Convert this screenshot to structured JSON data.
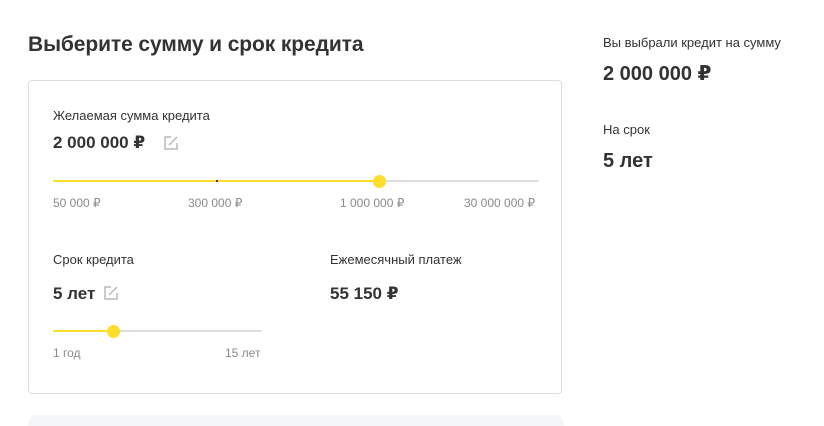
{
  "header": {
    "title": "Выберите сумму и срок кредита"
  },
  "amount": {
    "label": "Желаемая сумма кредита",
    "value": "2 000 000 ₽",
    "slider_fraction": 0.672,
    "ticks": [
      "50 000 ₽",
      "300 000 ₽",
      "1 000 000 ₽",
      "30 000 000 ₽"
    ]
  },
  "term": {
    "label": "Срок кредита",
    "value": "5 лет",
    "slider_fraction": 0.29,
    "ticks": [
      "1 год",
      "15 лет"
    ]
  },
  "payment": {
    "label": "Ежемесячный платеж",
    "value": "55 150 ₽"
  },
  "summary": {
    "amount_label": "Вы выбрали кредит на сумму",
    "amount_value": "2 000 000 ₽",
    "term_label": "На срок",
    "term_value": "5 лет"
  },
  "colors": {
    "accent": "#ffdd2d",
    "track": "#dddddd",
    "text": "#333333",
    "muted": "#8a8a8a"
  },
  "icons": {
    "edit": "edit-icon"
  }
}
